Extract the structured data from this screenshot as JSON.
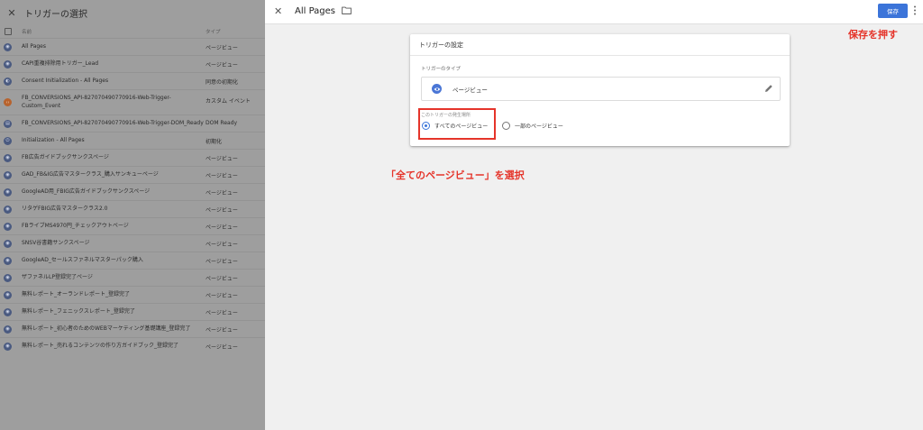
{
  "left_panel": {
    "title": "トリガーの選択",
    "close_glyph": "✕",
    "header": {
      "name": "名前",
      "type": "タイプ"
    },
    "rows": [
      {
        "name": "All Pages",
        "type": "ページビュー",
        "icon": "eye-icon"
      },
      {
        "name": "CAPI重複排除用トリガー_Lead",
        "type": "ページビュー",
        "icon": "eye-icon"
      },
      {
        "name": "Consent Initialization - All Pages",
        "type": "同意の初期化",
        "icon": "shield-icon"
      },
      {
        "name": "FB_CONVERSIONS_API-827070490770916-Web-Trigger-",
        "name2": "Custom_Event",
        "type": "カスタム イベント",
        "icon": "code-icon"
      },
      {
        "name": "FB_CONVERSIONS_API-827070490770916-Web-Trigger-DOM_Ready",
        "type": "DOM Ready",
        "icon": "doc-icon"
      },
      {
        "name": "Initialization - All Pages",
        "type": "初期化",
        "icon": "power-icon"
      },
      {
        "name": "FB広告ガイドブックサンクスページ",
        "type": "ページビュー",
        "icon": "eye-icon"
      },
      {
        "name": "GAD_FB&IG広告マスタークラス_購入サンキューページ",
        "type": "ページビュー",
        "icon": "eye-icon"
      },
      {
        "name": "GoogleAD用_FBIG広告ガイドブックサンクスページ",
        "type": "ページビュー",
        "icon": "eye-icon"
      },
      {
        "name": "リタゲFBIG広告マスタークラス2.0",
        "type": "ページビュー",
        "icon": "eye-icon"
      },
      {
        "name": "FBライブMS4970円_チェックアウトページ",
        "type": "ページビュー",
        "icon": "eye-icon"
      },
      {
        "name": "SNSV谷書籍サンクスページ",
        "type": "ページビュー",
        "icon": "eye-icon"
      },
      {
        "name": "GoogleAD_セールスファネルマスターパック購入",
        "type": "ページビュー",
        "icon": "eye-icon"
      },
      {
        "name": "ザファネルLP登録完了ページ",
        "type": "ページビュー",
        "icon": "eye-icon"
      },
      {
        "name": "無料レポート_オーランドレポート_登録完了",
        "type": "ページビュー",
        "icon": "eye-icon"
      },
      {
        "name": "無料レポート_フェニックスレポート_登録完了",
        "type": "ページビュー",
        "icon": "eye-icon"
      },
      {
        "name": "無料レポート_初心者のためのWEBマーケティング基礎講座_登録完了",
        "type": "ページビュー",
        "icon": "eye-icon"
      },
      {
        "name": "無料レポート_売れるコンテンツの作り方ガイドブック_登録完了",
        "type": "ページビュー",
        "icon": "eye-icon"
      }
    ]
  },
  "editor": {
    "close_glyph": "✕",
    "trigger_name": "All Pages",
    "save_label": "保存",
    "card": {
      "title": "トリガーの設定",
      "type_label": "トリガーのタイプ",
      "type_value": "ページビュー",
      "fire_label": "このトリガーの発生場所",
      "options": [
        {
          "label": "すべてのページビュー",
          "selected": true
        },
        {
          "label": "一部のページビュー",
          "selected": false
        }
      ]
    }
  },
  "annotations": {
    "save": "保存を押す",
    "select": "「全てのページビュー」を選択"
  },
  "colors": {
    "accent": "#3b74d9",
    "annotation": "#e5342a",
    "overlay": "#9e9e9e"
  }
}
